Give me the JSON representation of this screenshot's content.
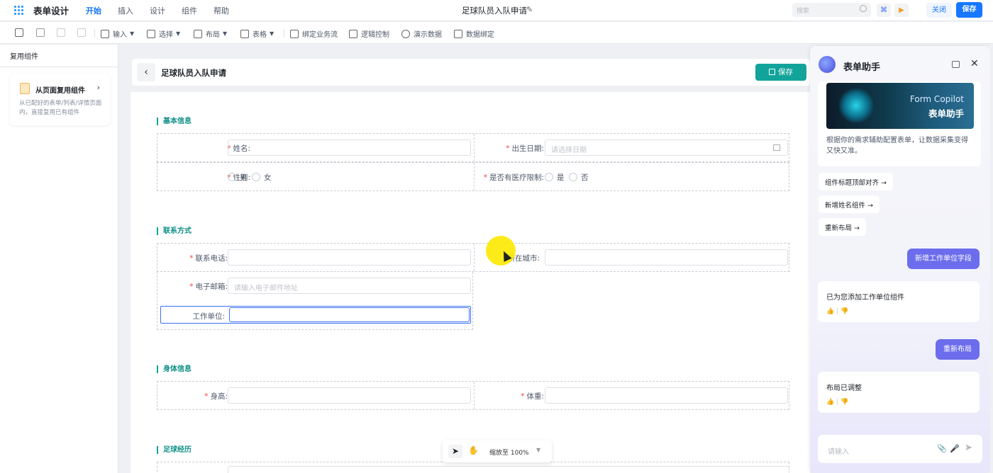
{
  "app": {
    "title": "表单设计",
    "doc_title": "足球队员入队申请"
  },
  "menu": [
    "开始",
    "插入",
    "设计",
    "组件",
    "帮助"
  ],
  "topbar": {
    "search_placeholder": "搜索",
    "close_label": "关闭",
    "save_label": "保存"
  },
  "toolbar": {
    "input": "输入",
    "select": "选择",
    "layout": "布局",
    "table": "表格",
    "bind_flow": "绑定业务流",
    "logic": "逻辑控制",
    "demo": "演示数据",
    "data_bind": "数据绑定"
  },
  "left_panel": {
    "title": "复用组件",
    "card_title": "从页面复用组件",
    "card_desc": "从已配好的表单/列表/详情页面内，直接复用已有组件"
  },
  "form": {
    "title": "足球队员入队申请",
    "save_label": "保存",
    "sections": {
      "basic": "基本信息",
      "contact": "联系方式",
      "body": "身体信息",
      "history": "足球经历"
    },
    "fields": {
      "name": "姓名:",
      "birth": "出生日期:",
      "birth_placeholder": "请选择日期",
      "gender": "性别:",
      "gender_male": "男",
      "gender_female": "女",
      "medical": "是否有医疗限制:",
      "medical_yes": "是",
      "medical_no": "否",
      "phone": "联系电话:",
      "city": "所在城市:",
      "email": "电子邮箱:",
      "email_placeholder": "请输入电子邮件地址",
      "work": "工作单位:",
      "height": "身高:",
      "weight": "体重:"
    }
  },
  "zoom": {
    "label": "缩放至 100%"
  },
  "assistant": {
    "title": "表单助手",
    "banner_sub": "Form Copilot",
    "banner_main": "表单助手",
    "description": "根据你的需求辅助配置表单，让数据采集变得又快又准。",
    "suggestions": [
      "组件标题顶部对齐 →",
      "新增姓名组件 →",
      "重新布局 →"
    ],
    "messages": [
      {
        "role": "user",
        "text": "新增工作单位字段"
      },
      {
        "role": "bot",
        "text": "已为您添加工作单位组件"
      },
      {
        "role": "user",
        "text": "重新布局"
      },
      {
        "role": "bot",
        "text": "布局已调整"
      }
    ],
    "input_placeholder": "请输入"
  }
}
